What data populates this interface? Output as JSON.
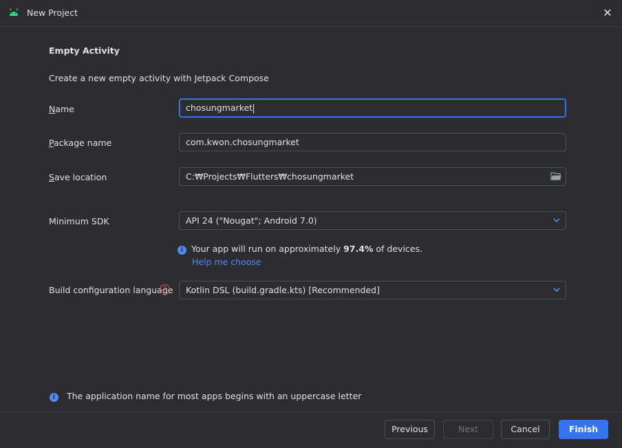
{
  "window": {
    "title": "New Project",
    "close_glyph": "✕"
  },
  "form": {
    "heading": "Empty Activity",
    "description": "Create a new empty activity with Jetpack Compose",
    "name": {
      "label_first": "N",
      "label_rest": "ame",
      "value": "chosungmarket"
    },
    "package": {
      "label_first": "P",
      "label_rest": "ackage name",
      "value": "com.kwon.chosungmarket"
    },
    "save_location": {
      "label_first": "S",
      "label_rest": "ave location",
      "value": "C:₩Projects₩Flutters₩chosungmarket"
    },
    "min_sdk": {
      "label": "Minimum SDK",
      "value": "API 24 (\"Nougat\"; Android 7.0)"
    },
    "sdk_info": {
      "prefix": "Your app will run on approximately ",
      "percent": "97.4%",
      "suffix": " of devices.",
      "help_link": "Help me choose"
    },
    "build_language": {
      "label": "Build configuration language",
      "value": "Kotlin DSL (build.gradle.kts) [Recommended]"
    }
  },
  "footer": {
    "hint": "The application name for most apps begins with an uppercase letter",
    "buttons": {
      "previous": "Previous",
      "next": "Next",
      "cancel": "Cancel",
      "finish": "Finish"
    }
  },
  "colors": {
    "accent": "#3574f0",
    "link": "#548af7",
    "android_green": "#3ddc84",
    "help_red": "#db5c5c"
  },
  "icons": [
    "android-icon",
    "close-icon",
    "folder-icon",
    "chevron-down-icon",
    "info-icon",
    "help-icon"
  ]
}
